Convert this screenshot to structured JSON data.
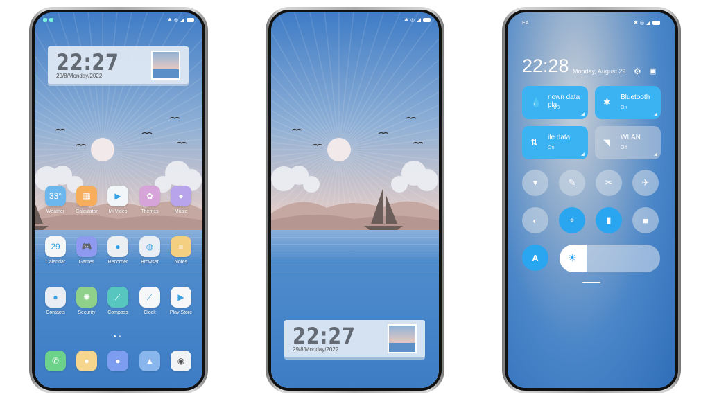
{
  "phone1": {
    "widget": {
      "time": "22:27",
      "date": "29/8/Monday/2022"
    },
    "apps": [
      {
        "label": "Weather",
        "icon": "weather-icon",
        "glyph": "33°",
        "color": "#6bb7ee"
      },
      {
        "label": "Calculator",
        "icon": "calculator-icon",
        "glyph": "▦",
        "color": "#f6ae5d"
      },
      {
        "label": "Mi Video",
        "icon": "play-icon",
        "glyph": "▶",
        "color": "#f2f6f9"
      },
      {
        "label": "Themes",
        "icon": "shell-icon",
        "glyph": "✿",
        "color": "#d6a4d8"
      },
      {
        "label": "Music",
        "icon": "music-icon",
        "glyph": "●",
        "color": "#b8a4ea"
      },
      {
        "label": "Calendar",
        "icon": "calendar-icon",
        "glyph": "29",
        "color": "#f4f6f8"
      },
      {
        "label": "Games",
        "icon": "gamepad-icon",
        "glyph": "🎮",
        "color": "#8d9af0"
      },
      {
        "label": "Recorder",
        "icon": "recorder-icon",
        "glyph": "●",
        "color": "#eceff2"
      },
      {
        "label": "Browser",
        "icon": "browser-icon",
        "glyph": "◍",
        "color": "#e8eef4"
      },
      {
        "label": "Notes",
        "icon": "notes-icon",
        "glyph": "≡",
        "color": "#f4cf82"
      },
      {
        "label": "Contacts",
        "icon": "contacts-icon",
        "glyph": "●",
        "color": "#e8eef4"
      },
      {
        "label": "Security",
        "icon": "security-icon",
        "glyph": "✺",
        "color": "#8fd08b"
      },
      {
        "label": "Compass",
        "icon": "compass-icon",
        "glyph": "⟋",
        "color": "#56c6be"
      },
      {
        "label": "Clock",
        "icon": "clock-icon",
        "glyph": "⟋",
        "color": "#f6f7f9"
      },
      {
        "label": "Play Store",
        "icon": "play-store-icon",
        "glyph": "▶",
        "color": "#f6f7f9"
      }
    ],
    "dock": [
      {
        "icon": "phone-icon",
        "glyph": "✆",
        "color": "#6dd38a"
      },
      {
        "icon": "messages-icon",
        "glyph": "●",
        "color": "#f6d58d"
      },
      {
        "icon": "camera-icon",
        "glyph": "●",
        "color": "#7d9df0"
      },
      {
        "icon": "gallery-icon",
        "glyph": "▲",
        "color": "#89b6ec"
      },
      {
        "icon": "camera-lens-icon",
        "glyph": "◉",
        "color": "#f2f3f5"
      }
    ]
  },
  "phone2": {
    "widget": {
      "time": "22:27",
      "date": "29/8/Monday/2022"
    }
  },
  "phone3": {
    "carrier": "EA",
    "time": "22:28",
    "date": "Monday, August 29",
    "tiles": [
      {
        "title": "nown data pla",
        "sub": "-- MB",
        "icon": "water-drop-icon",
        "glyph": "💧",
        "on": true
      },
      {
        "title": "Bluetooth",
        "sub": "On",
        "icon": "bluetooth-icon",
        "glyph": "✱",
        "on": true
      },
      {
        "title": "ile data",
        "sub": "On",
        "icon": "mobile-data-icon",
        "glyph": "⇅",
        "on": true
      },
      {
        "title": "WLAN",
        "sub": "Off",
        "icon": "wifi-icon",
        "glyph": "◥",
        "on": false
      }
    ],
    "toggles": [
      {
        "icon": "flashlight-icon",
        "glyph": "▾",
        "on": false
      },
      {
        "icon": "edit-icon",
        "glyph": "✎",
        "on": false
      },
      {
        "icon": "screenshot-icon",
        "glyph": "✂",
        "on": false
      },
      {
        "icon": "airplane-icon",
        "glyph": "✈",
        "on": false
      },
      {
        "icon": "dark-mode-icon",
        "glyph": "◐",
        "on": false
      },
      {
        "icon": "location-icon",
        "glyph": "⌖",
        "on": true
      },
      {
        "icon": "rotation-lock-icon",
        "glyph": "▮",
        "on": true
      },
      {
        "icon": "video-icon",
        "glyph": "■",
        "on": false
      }
    ],
    "auto_brightness_label": "A",
    "brightness": 0.27,
    "accent": "#2aa5ef"
  }
}
